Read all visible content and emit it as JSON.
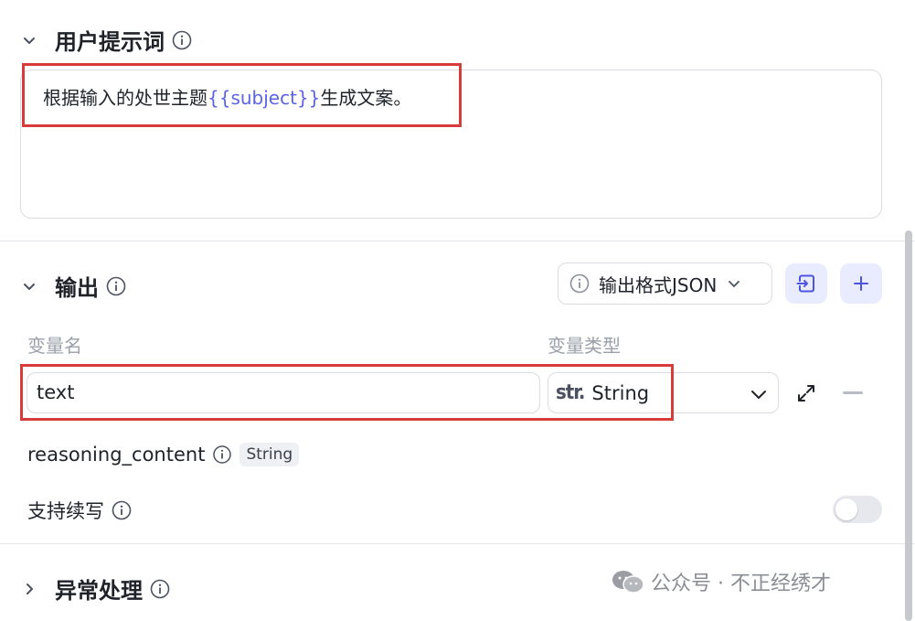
{
  "user_prompt": {
    "title": "用户提示词",
    "text_before": "根据输入的处世主题",
    "variable": "{{subject}}",
    "text_after": "生成文案。"
  },
  "output": {
    "title": "输出",
    "format_label": "输出格式JSON",
    "col_var_name": "变量名",
    "col_var_type": "变量类型",
    "var_name_value": "text",
    "type_prefix": "str.",
    "type_value": "String",
    "reasoning_name": "reasoning_content",
    "reasoning_type": "String",
    "resume_label": "支持续写",
    "resume_enabled": false
  },
  "exception": {
    "title": "异常处理"
  },
  "watermark": {
    "text": "公众号 · 不正经绣才"
  },
  "colors": {
    "accent": "#5b63e8",
    "highlight_border": "#d93a3a",
    "tool_button_bg": "#e9ebff"
  }
}
